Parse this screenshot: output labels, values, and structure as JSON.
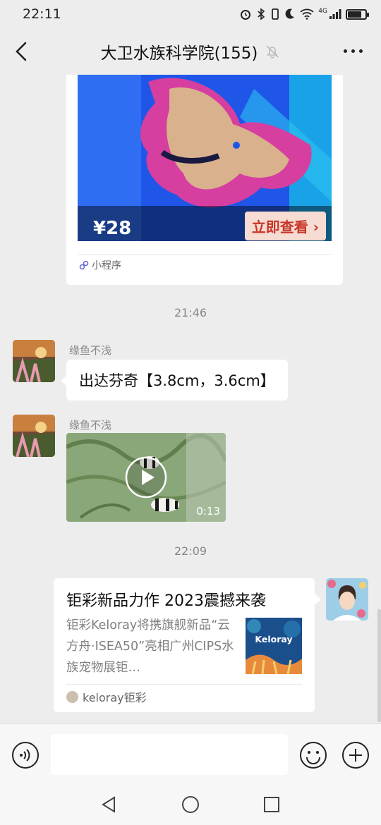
{
  "status": {
    "time": "22:11",
    "network": "4G",
    "battery_level": 0.8
  },
  "header": {
    "title": "大卫水族科学院(155)"
  },
  "mini_program": {
    "price": "¥28",
    "cta": "立即查看",
    "source": "小程序"
  },
  "messages": {
    "time_1": "21:46",
    "msg1": {
      "sender": "缘鱼不浅",
      "text": "出达芬奇【3.8cm，3.6cm】"
    },
    "msg2": {
      "sender": "缘鱼不浅",
      "video_duration": "0:13"
    },
    "time_2": "22:09",
    "article": {
      "title": "钜彩新品力作 2023震撼来袭",
      "description": "钜彩Keloray将携旗舰新品“云方舟·ISEA50”亮相广州CIPS水族宠物展钜…",
      "thumb_brand": "Keloray",
      "source": "keloray钜彩"
    }
  },
  "input": {
    "placeholder": ""
  },
  "icons": {
    "back": "chevron-left-icon",
    "mute": "bell-off-icon",
    "more": "more-icon",
    "voice": "voice-icon",
    "emoji": "emoji-icon",
    "plus": "plus-icon"
  }
}
